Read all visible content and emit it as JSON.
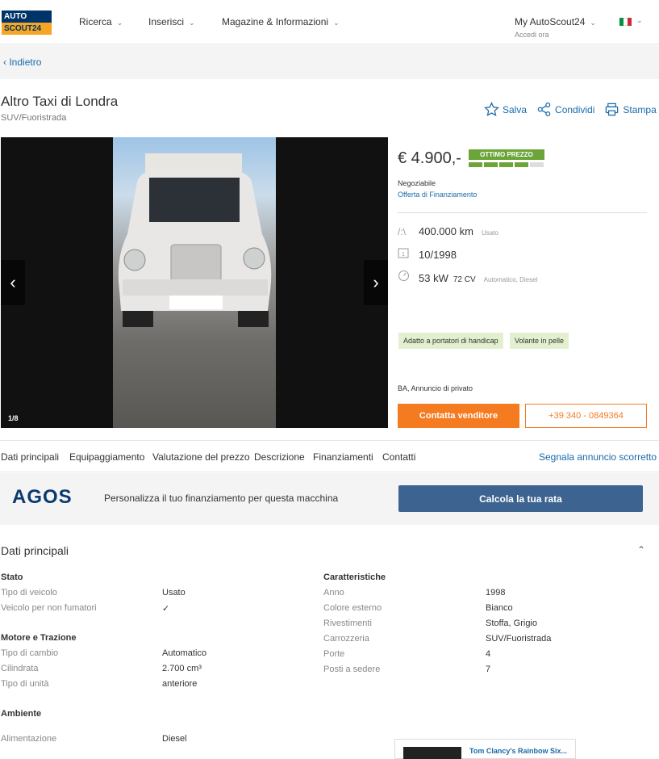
{
  "header": {
    "logo_top": "AUTO",
    "logo_bottom": "SCOUT24",
    "nav": [
      "Ricerca",
      "Inserisci",
      "Magazine & Informazioni"
    ],
    "my_account": "My AutoScout24",
    "my_account_sub": "Accedi ora",
    "flag_colors": [
      "#009246",
      "#ffffff",
      "#ce2b37"
    ]
  },
  "back_label": "Indietro",
  "listing": {
    "title": "Altro Taxi di Londra",
    "body_type": "SUV/Fuoristrada",
    "actions": {
      "save": "Salva",
      "share": "Condividi",
      "print": "Stampa"
    },
    "gallery_counter": "1/8",
    "price": "€ 4.900,-",
    "price_rating": "OTTIMO PREZZO",
    "price_rating_level": 4,
    "price_rating_max": 5,
    "negotiable": "Negoziabile",
    "financing_offer": "Offerta di Finanziamento",
    "mileage": "400.000 km",
    "condition": "Usato",
    "registration": "10/1998",
    "power": "53 kW",
    "power_cv": "72 CV",
    "power_note": "Automatico, Diesel",
    "features": [
      "Adatto a portatori di handicap",
      "Volante in pelle"
    ],
    "location": "BA, Annuncio di privato",
    "contact_label": "Contatta venditore",
    "phone": "+39 340 - 0849364"
  },
  "tabs": [
    "Dati principali",
    "Equipaggiamento",
    "Valutazione del prezzo",
    "Descrizione",
    "Finanziamenti",
    "Contatti"
  ],
  "report_label": "Segnala annuncio scorretto",
  "finance": {
    "brand": "AGOS",
    "text": "Personalizza il tuo finanziamento per questa macchina",
    "button": "Calcola la tua rata"
  },
  "details": {
    "title": "Dati principali",
    "stato": {
      "heading": "Stato",
      "rows": [
        {
          "k": "Tipo di veicolo",
          "v": "Usato"
        },
        {
          "k": "Veicolo per non fumatori",
          "v": "✓"
        }
      ]
    },
    "motore": {
      "heading": "Motore e Trazione",
      "rows": [
        {
          "k": "Tipo di cambio",
          "v": "Automatico"
        },
        {
          "k": "Cilindrata",
          "v": "2.700 cm³"
        },
        {
          "k": "Tipo di unità",
          "v": "anteriore"
        }
      ]
    },
    "ambiente": {
      "heading": "Ambiente",
      "rows": [
        {
          "k": "Alimentazione",
          "v": "Diesel"
        }
      ]
    },
    "caratteristiche": {
      "heading": "Caratteristiche",
      "rows": [
        {
          "k": "Anno",
          "v": "1998"
        },
        {
          "k": "Colore esterno",
          "v": "Bianco"
        },
        {
          "k": "Rivestimenti",
          "v": "Stoffa, Grigio"
        },
        {
          "k": "Carrozzeria",
          "v": "SUV/Fuoristrada"
        },
        {
          "k": "Porte",
          "v": "4"
        },
        {
          "k": "Posti a sedere",
          "v": "7"
        }
      ]
    }
  },
  "ad": {
    "text": "Tom Clancy's Rainbow Six..."
  }
}
